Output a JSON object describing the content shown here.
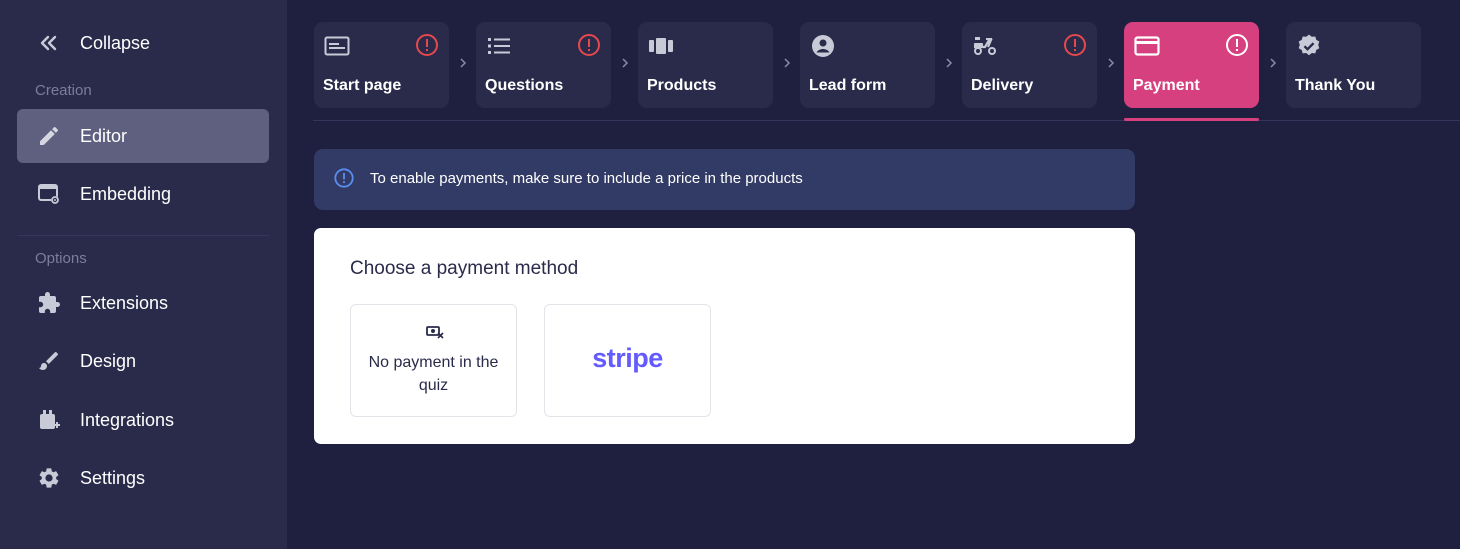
{
  "sidebar": {
    "collapse_label": "Collapse",
    "sections": {
      "creation": "Creation",
      "options": "Options"
    },
    "items": [
      {
        "label": "Editor",
        "icon": "pencil-icon",
        "active": true
      },
      {
        "label": "Embedding",
        "icon": "embed-window-icon",
        "active": false
      },
      {
        "label": "Extensions",
        "icon": "puzzle-icon",
        "active": false
      },
      {
        "label": "Design",
        "icon": "brush-icon",
        "active": false
      },
      {
        "label": "Integrations",
        "icon": "integrations-icon",
        "active": false
      },
      {
        "label": "Settings",
        "icon": "gear-icon",
        "active": false
      }
    ]
  },
  "steps": [
    {
      "label": "Start page",
      "icon": "start-page-icon",
      "warning": true,
      "active": false
    },
    {
      "label": "Questions",
      "icon": "list-icon",
      "warning": true,
      "active": false
    },
    {
      "label": "Products",
      "icon": "products-icon",
      "warning": false,
      "active": false
    },
    {
      "label": "Lead form",
      "icon": "account-circle-icon",
      "warning": false,
      "active": false
    },
    {
      "label": "Delivery",
      "icon": "scooter-icon",
      "warning": true,
      "active": false
    },
    {
      "label": "Payment",
      "icon": "credit-card-icon",
      "warning": true,
      "active": true
    },
    {
      "label": "Thank You",
      "icon": "verified-badge-icon",
      "warning": false,
      "active": false
    }
  ],
  "info_banner": {
    "text": "To enable payments, make sure to include a price in the products",
    "icon": "info-icon"
  },
  "payment": {
    "title": "Choose a payment method",
    "options": [
      {
        "label": "No payment in the quiz",
        "icon": "no-payment-icon"
      },
      {
        "label": "stripe",
        "icon": "stripe-logo"
      }
    ]
  },
  "colors": {
    "background": "#1f2040",
    "sidebar": "#2a2b4a",
    "sidebar_active": "#5f6080",
    "accent": "#d6407f",
    "warning": "#e5484d",
    "info_banner": "#323a66",
    "stripe": "#635bff"
  }
}
